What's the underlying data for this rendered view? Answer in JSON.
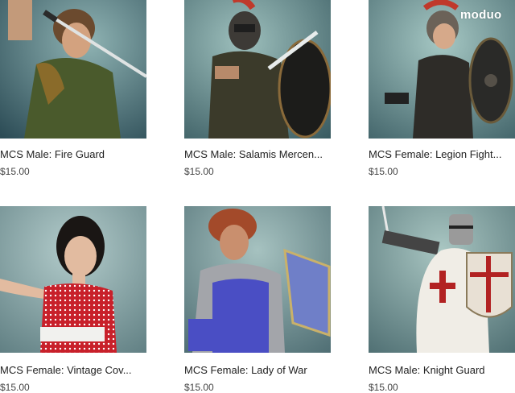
{
  "brand": {
    "logo_text": "moduo"
  },
  "products": [
    {
      "name": "MCS Male: Fire Guard",
      "price": "$15.00",
      "icon": "fire-guard-portrait"
    },
    {
      "name": "MCS Male: Salamis Mercen...",
      "price": "$15.00",
      "icon": "salamis-mercenary-portrait"
    },
    {
      "name": "MCS Female: Legion Fight...",
      "price": "$15.00",
      "icon": "legion-fighter-portrait"
    },
    {
      "name": "MCS Female: Vintage Cov...",
      "price": "$15.00",
      "icon": "vintage-cover-portrait"
    },
    {
      "name": "MCS Female: Lady of War",
      "price": "$15.00",
      "icon": "lady-of-war-portrait"
    },
    {
      "name": "MCS Male: Knight Guard",
      "price": "$15.00",
      "icon": "knight-guard-portrait"
    }
  ],
  "colors": {
    "thumb_bg": "#5a7c86",
    "text": "#222222",
    "price_text": "#444444"
  }
}
